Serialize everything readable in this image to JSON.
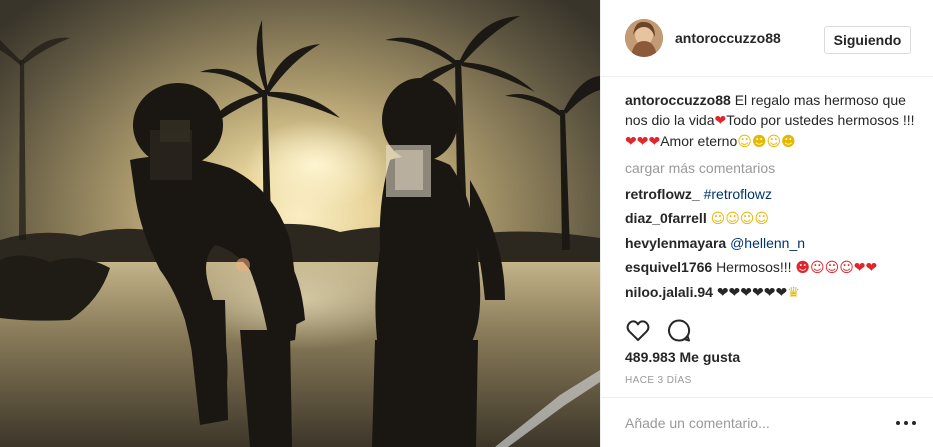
{
  "post": {
    "username": "antoroccuzzo88",
    "follow_label": "Siguiendo",
    "caption_user": "antoroccuzzo88",
    "caption_text": " El regalo mas hermoso que nos dio la vida",
    "caption_text_2": "Todo por ustedes hermosos !!! ",
    "caption_text_3": "Amor eterno",
    "caption_heart": "❤",
    "caption_hearts": "❤❤❤",
    "caption_faces": "☺☻☺☻",
    "load_more": "cargar más comentarios",
    "comments": [
      {
        "user": "retroflowz_",
        "text": "#retroflowz"
      },
      {
        "user": "diaz_0farrell",
        "text": "☺☺☺☺"
      },
      {
        "user": "hevylenmayara",
        "text": "@hellenn_n"
      },
      {
        "user": "esquivel1766",
        "text": "Hermosos!!! ",
        "emoji": "☻☺☺☺❤❤"
      },
      {
        "user": "niloo.jalali.94",
        "text": "❤❤❤❤❤❤",
        "emoji": "♛"
      }
    ],
    "likes": "489.983 Me gusta",
    "time_ago": "HACE 3 DÍAS",
    "comment_placeholder": "Añade un comentario..."
  },
  "icons": {
    "like": "heart-outline-icon",
    "comment": "speech-bubble-icon",
    "more": "ellipsis-icon"
  },
  "colors": {
    "link": "#003569",
    "muted": "#999999",
    "text": "#262626",
    "heart": "#e0262c",
    "border": "#efefef"
  }
}
